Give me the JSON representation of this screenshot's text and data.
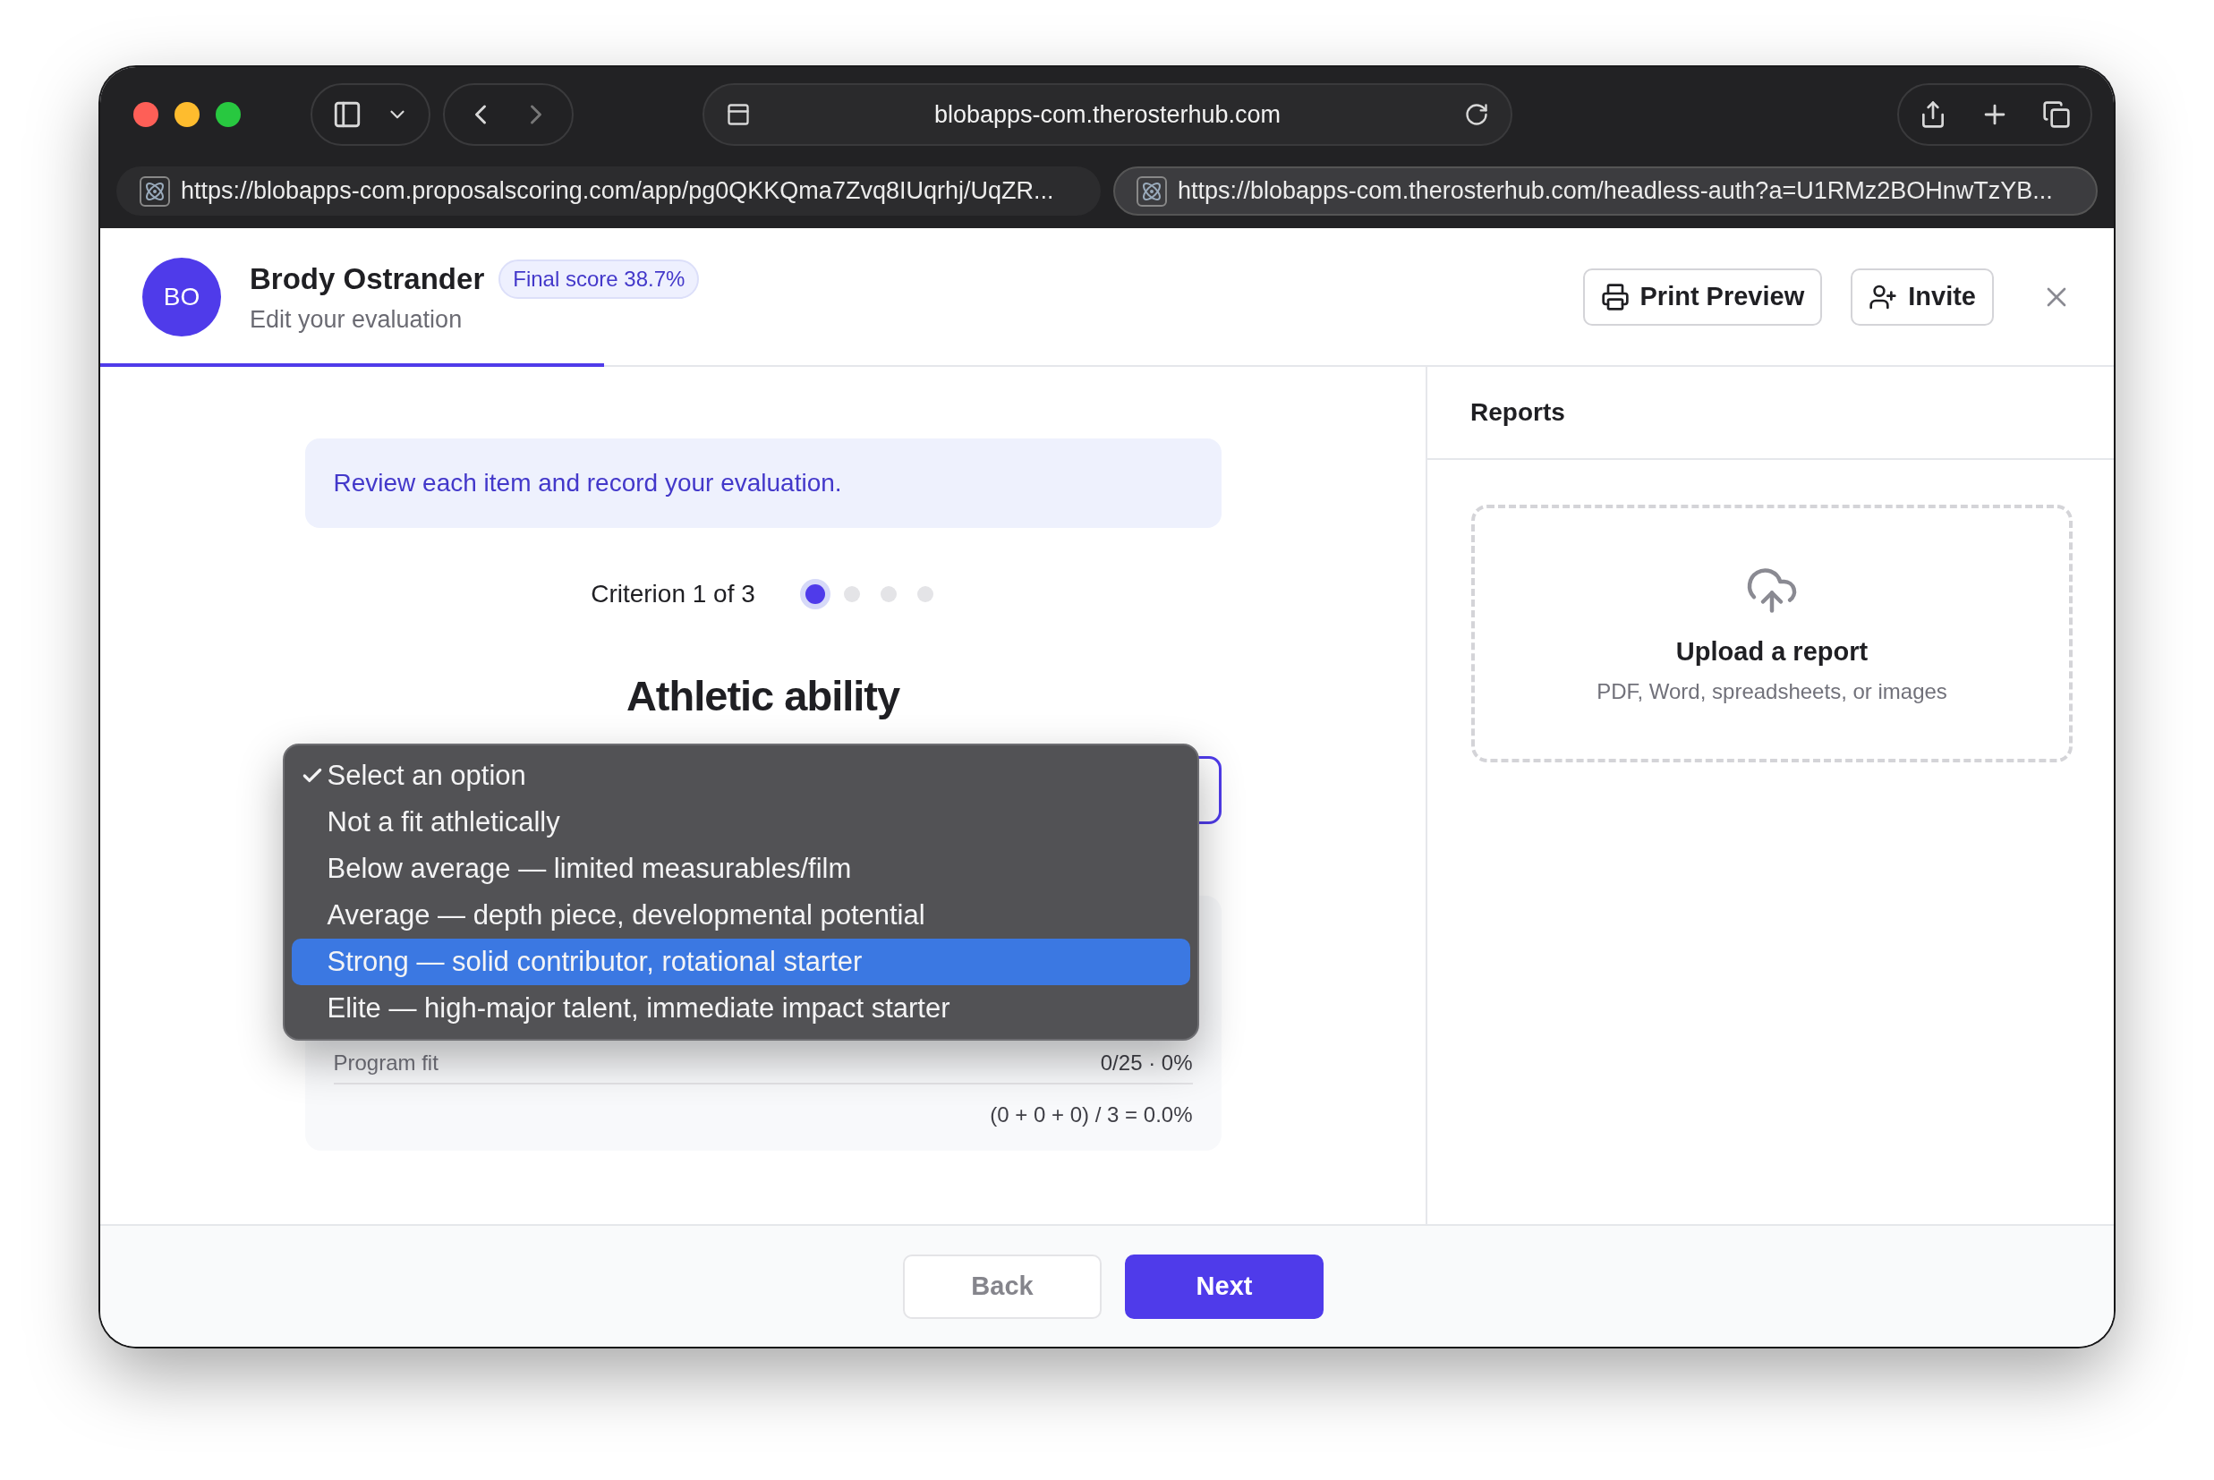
{
  "browser": {
    "address": "blobapps-com.therosterhub.com",
    "tabs": [
      {
        "url": "https://blobapps-com.proposalscoring.com/app/pg0QKKQma7Zvq8IUqrhj/UqZR...",
        "selected": false
      },
      {
        "url": "https://blobapps-com.therosterhub.com/headless-auth?a=U1RMz2BOHnwTzYB...",
        "selected": true
      }
    ]
  },
  "header": {
    "avatar": "BO",
    "name": "Brody Ostrander",
    "badge": "Final score 38.7%",
    "subtitle": "Edit your evaluation",
    "print_button": "Print Preview",
    "invite_button": "Invite",
    "progress": {
      "level": 0.25
    }
  },
  "evaluation": {
    "notice": "Review each item and record your evaluation.",
    "step_label": "Criterion 1 of 3",
    "steps": [
      {
        "selected": true
      },
      {
        "selected": false
      },
      {
        "selected": false
      },
      {
        "selected": false
      }
    ],
    "criterion": "Athletic ability",
    "dropdown": {
      "options": [
        {
          "label": "Select an option",
          "checked": true,
          "highlighted": false
        },
        {
          "label": "Not a fit athletically",
          "checked": false,
          "highlighted": false
        },
        {
          "label": "Below average — limited measurables/film",
          "checked": false,
          "highlighted": false
        },
        {
          "label": "Average — depth piece, developmental potential",
          "checked": false,
          "highlighted": false
        },
        {
          "label": "Strong — solid contributor, rotational starter",
          "checked": false,
          "highlighted": true
        },
        {
          "label": "Elite — high-major talent, immediate impact starter",
          "checked": false,
          "highlighted": false
        }
      ]
    },
    "summary": {
      "rows": [
        {
          "label": "Program fit",
          "value": "0/25 · 0%"
        }
      ],
      "total": "(0 + 0 + 0) / 3 = 0.0%"
    }
  },
  "reports": {
    "title": "Reports",
    "upload_title": "Upload a report",
    "upload_hint": "PDF, Word, spreadsheets, or images"
  },
  "footer": {
    "buttons": [
      {
        "label": "Back",
        "kind": "secondary"
      },
      {
        "label": "Next",
        "kind": "primary"
      }
    ]
  }
}
